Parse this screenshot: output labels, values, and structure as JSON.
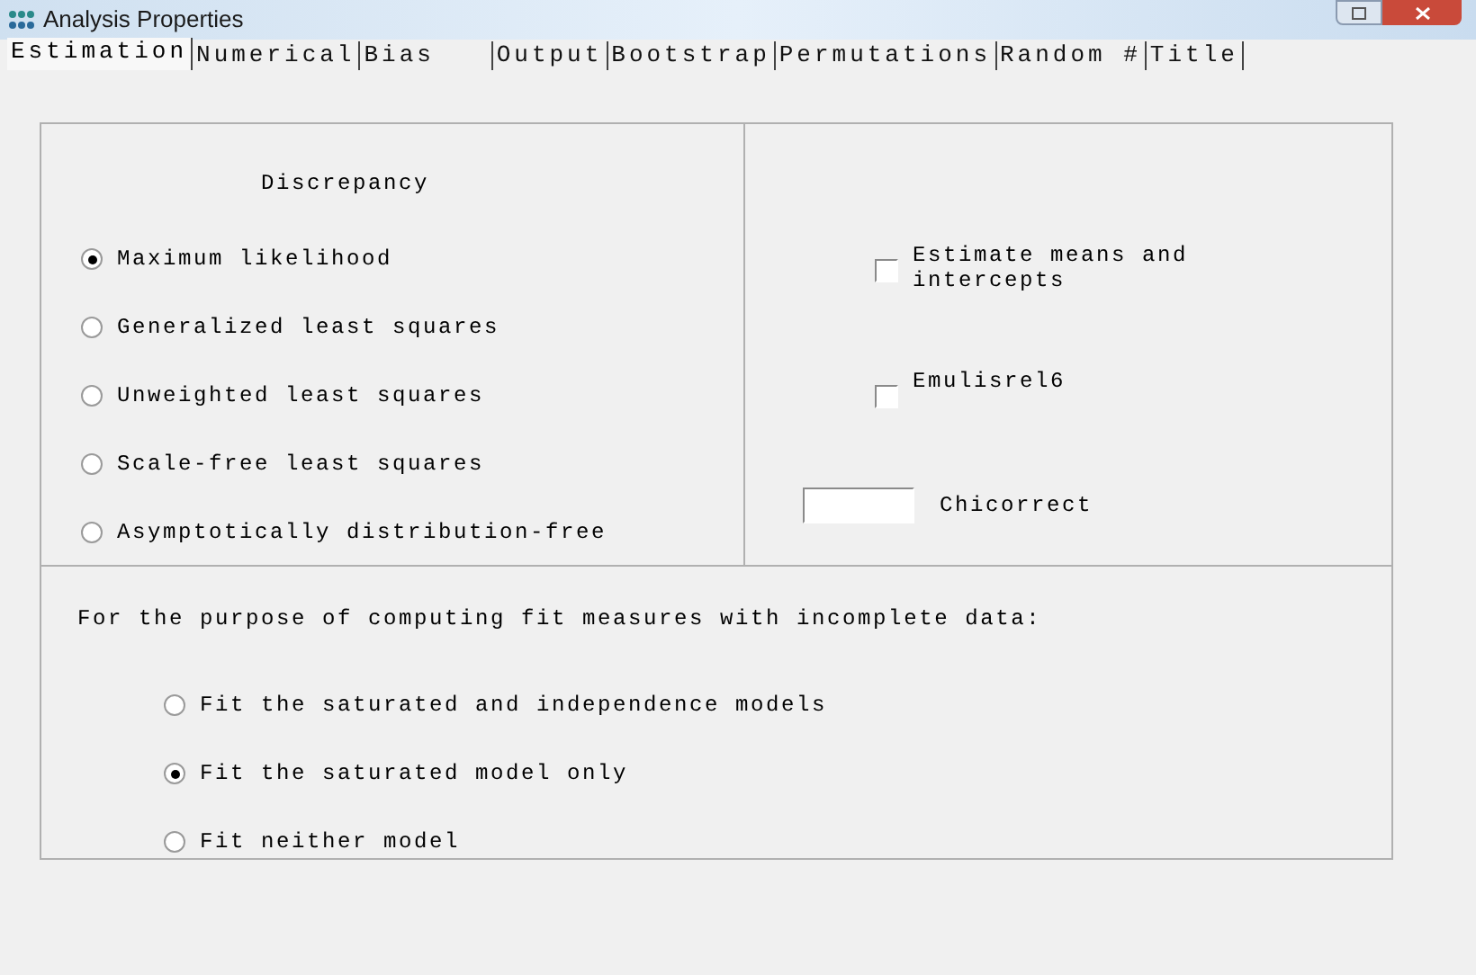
{
  "window": {
    "title": "Analysis Properties"
  },
  "tabs": [
    {
      "label": "Estimation",
      "selected": true
    },
    {
      "label": "Numerical",
      "selected": false
    },
    {
      "label": "Bias   ",
      "selected": false
    },
    {
      "label": "Output",
      "selected": false
    },
    {
      "label": "Bootstrap",
      "selected": false
    },
    {
      "label": "Permutations",
      "selected": false
    },
    {
      "label": "Random #",
      "selected": false
    },
    {
      "label": "Title",
      "selected": false
    }
  ],
  "discrepancy": {
    "title": "Discrepancy",
    "options": [
      {
        "label": "Maximum likelihood",
        "selected": true
      },
      {
        "label": "Generalized least squares",
        "selected": false
      },
      {
        "label": "Unweighted least squares",
        "selected": false
      },
      {
        "label": "Scale-free least squares",
        "selected": false
      },
      {
        "label": "Asymptotically distribution-free",
        "selected": false
      }
    ]
  },
  "options": [
    {
      "label": "Estimate means and intercepts",
      "checked": false
    },
    {
      "label": "Emulisrel6",
      "checked": false
    }
  ],
  "chicorrect": {
    "label": "Chicorrect"
  },
  "incomplete_data": {
    "caption": "For the purpose of computing fit measures with incomplete data:",
    "options": [
      {
        "label": "Fit the saturated and independence models",
        "selected": false
      },
      {
        "label": "Fit the saturated model only",
        "selected": true
      },
      {
        "label": "Fit neither model",
        "selected": false
      }
    ]
  }
}
